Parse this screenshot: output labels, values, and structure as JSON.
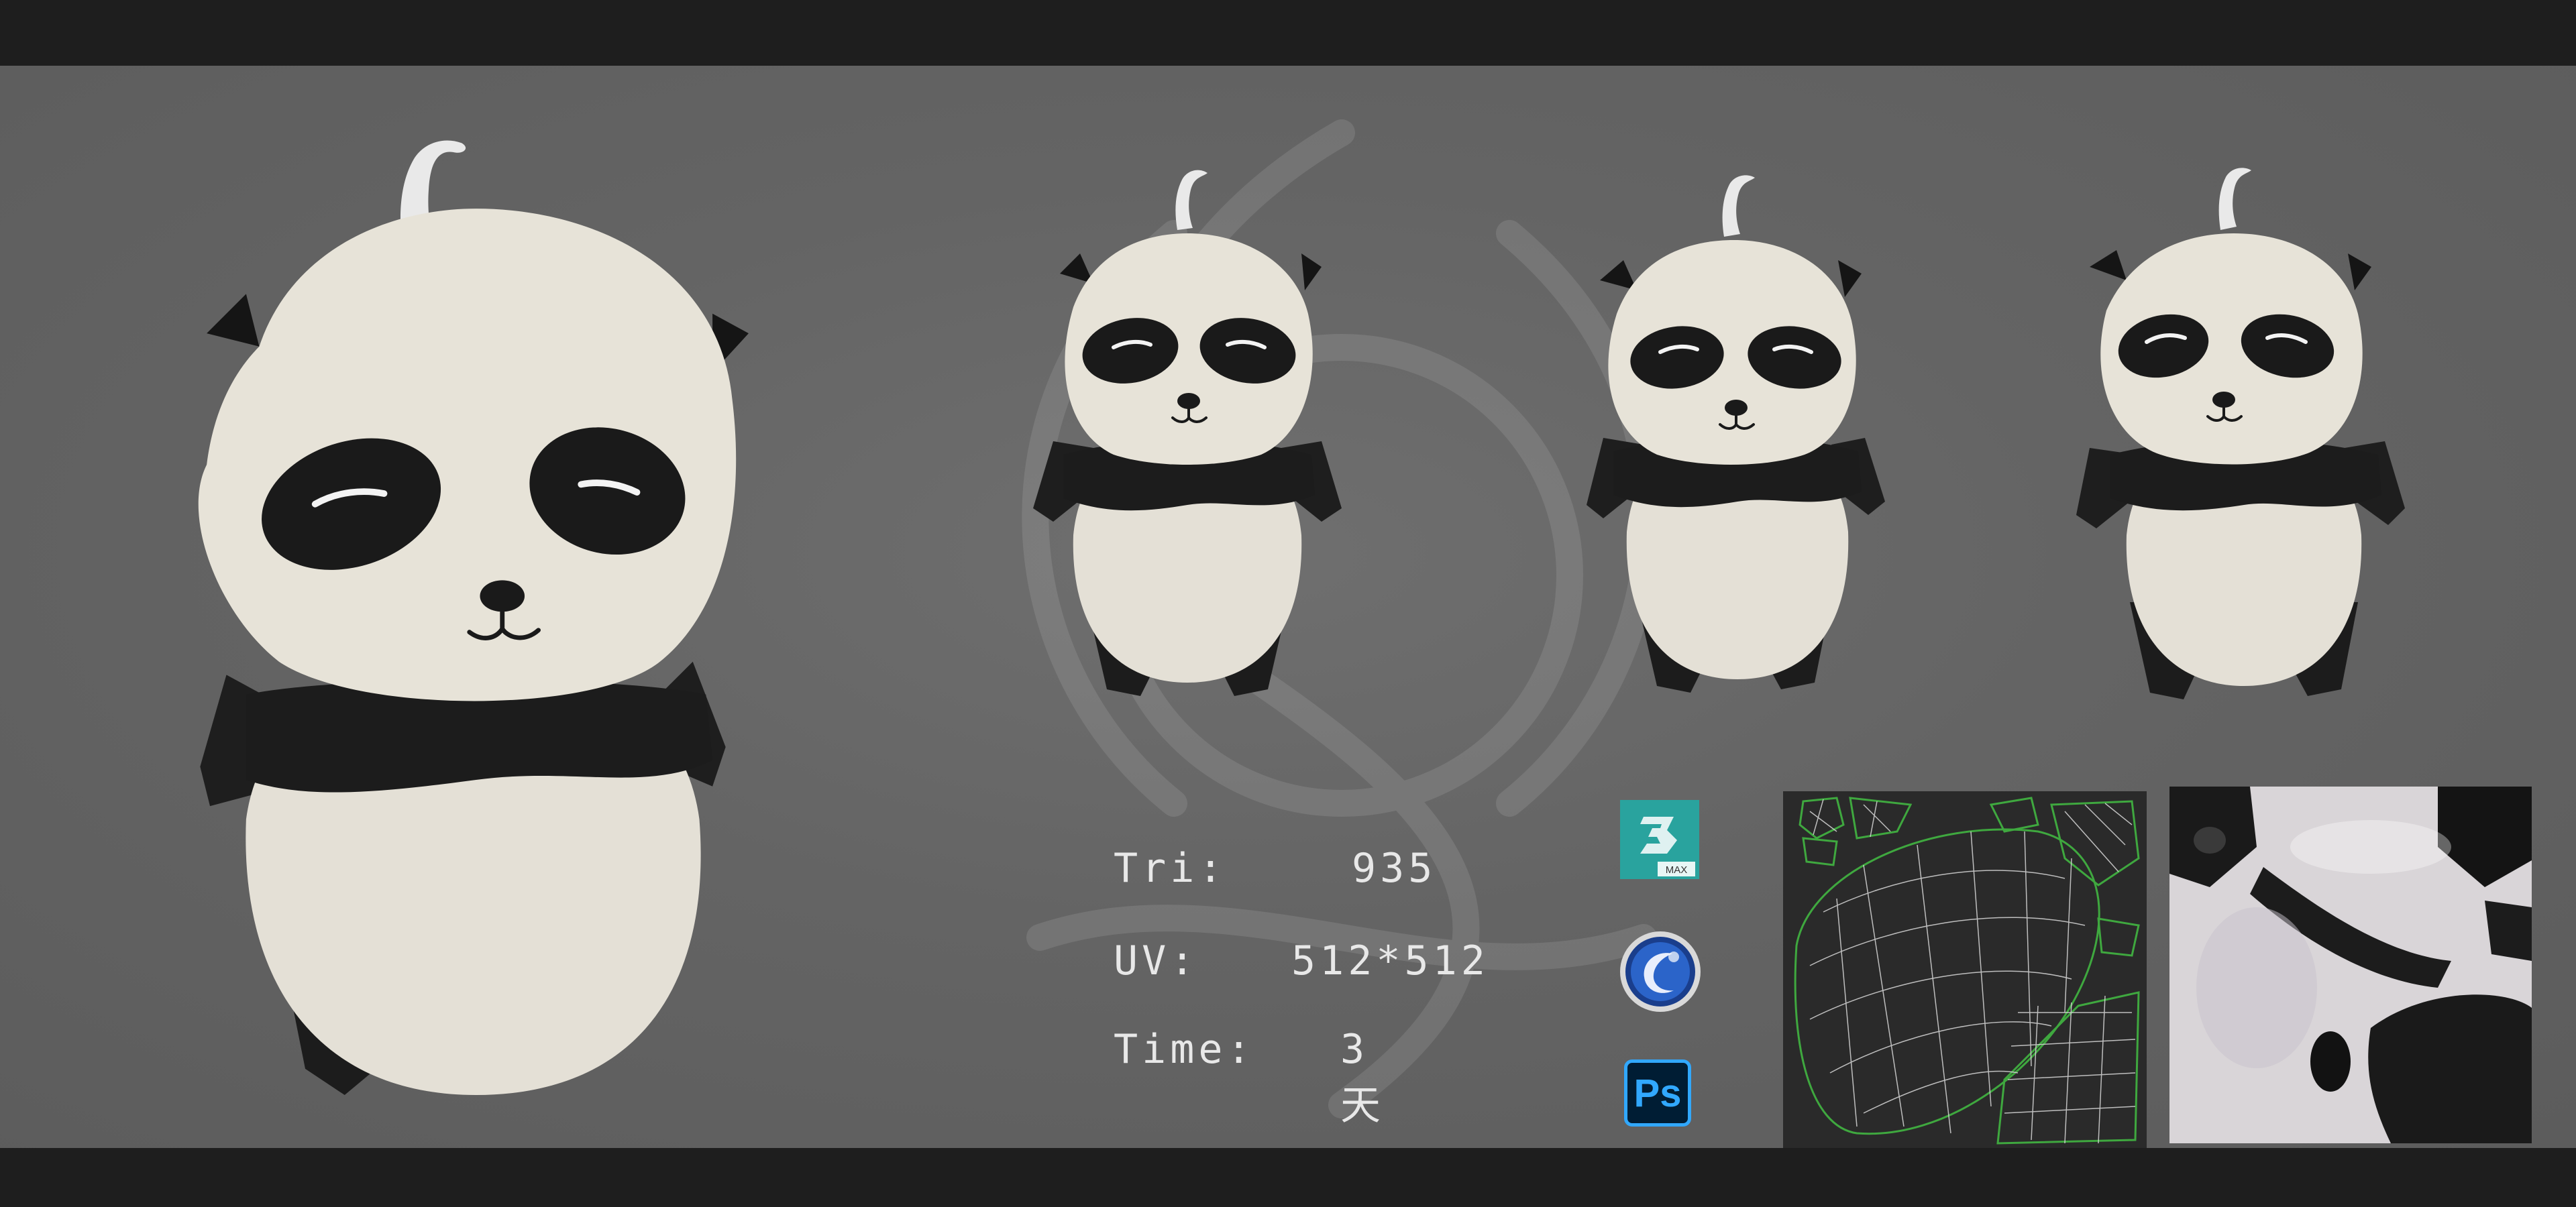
{
  "specs": {
    "triangles": {
      "label": "Tri:",
      "value": "935"
    },
    "uv": {
      "label": "UV:",
      "value": "512*512"
    },
    "time": {
      "label": "Time:",
      "value": "3天"
    }
  },
  "software_icons": [
    {
      "name": "3ds-max-icon",
      "caption": "MAX"
    },
    {
      "name": "cinema-4d-icon"
    },
    {
      "name": "photoshop-icon",
      "caption": "Ps"
    }
  ],
  "colors": {
    "background": "#666666",
    "frame_bars": "#1e1e1e",
    "panda_fur": "#e6e1d6",
    "panda_black": "#1c1c1c",
    "uv_wire": "#3fa83f",
    "text": "#e8e8e8"
  }
}
